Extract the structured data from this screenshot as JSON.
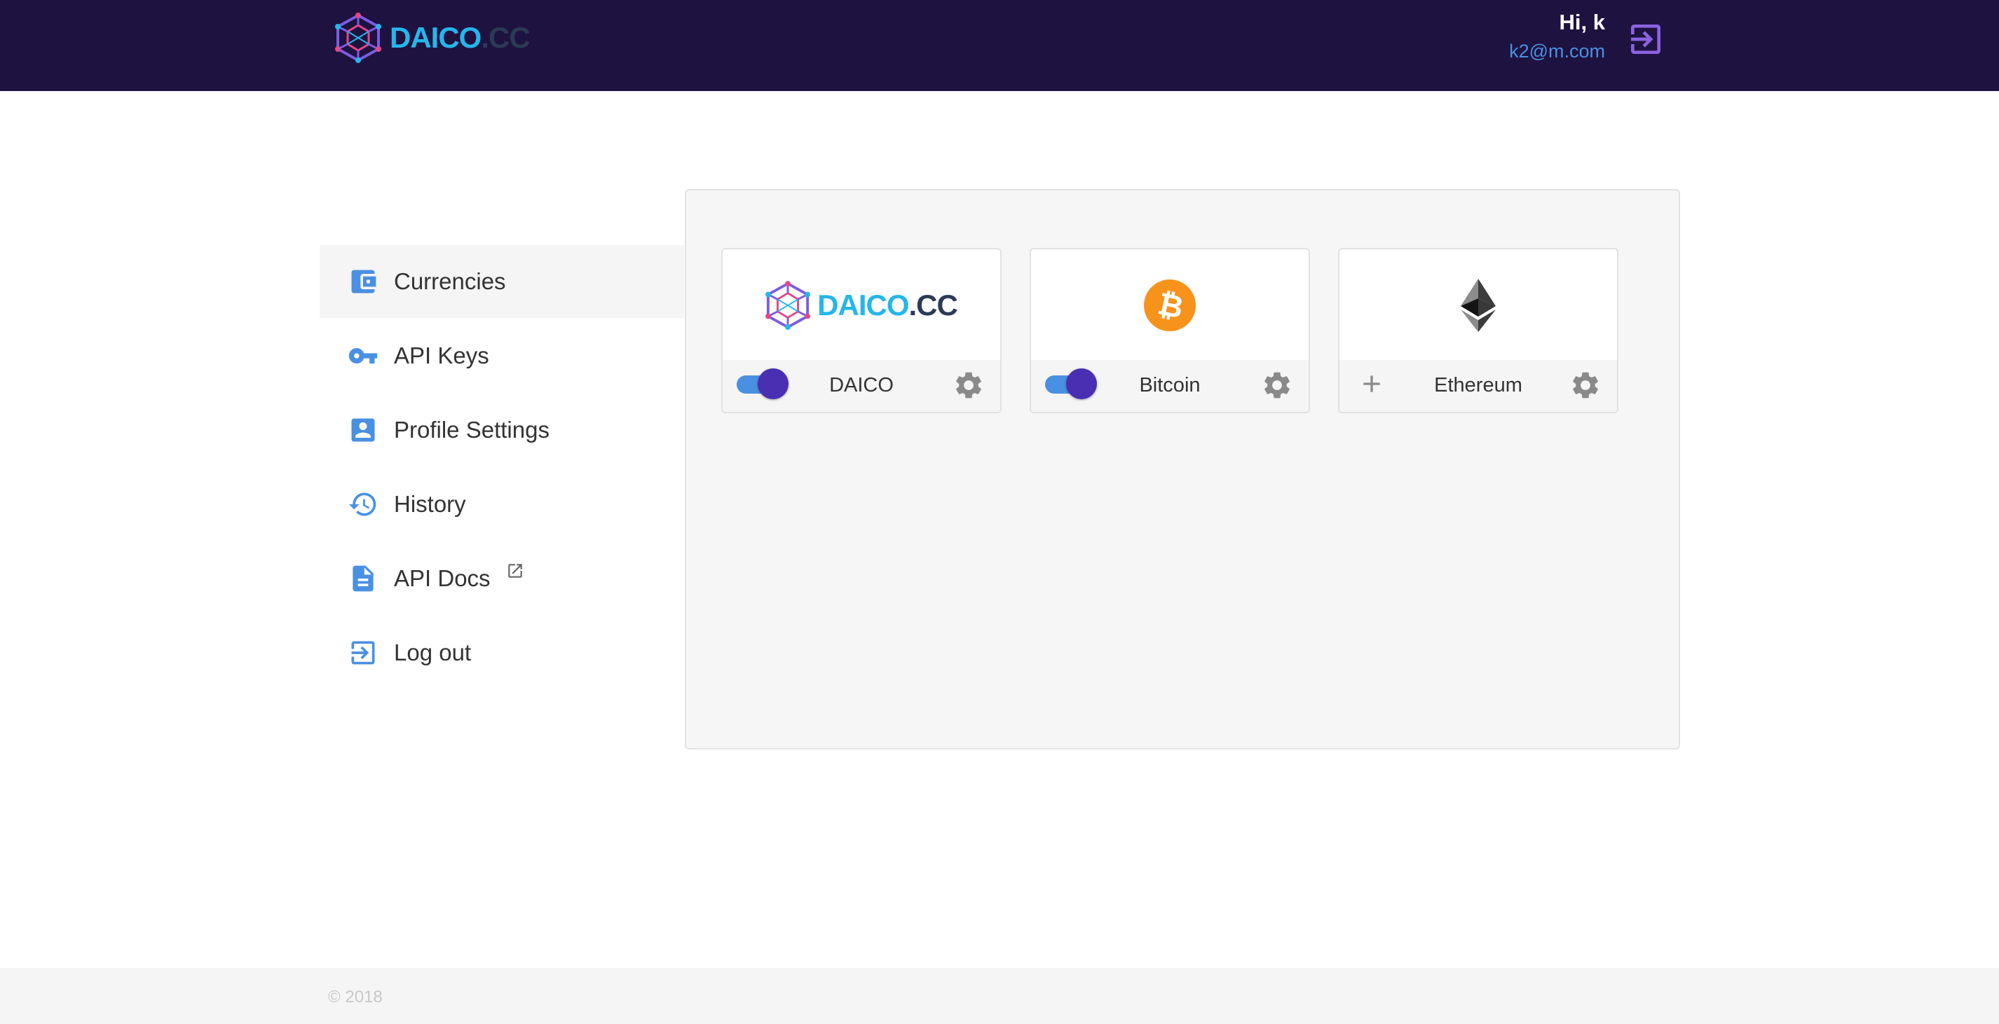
{
  "header": {
    "brand": {
      "part1": "DAICO",
      "part2": ".CC"
    },
    "greeting": "Hi, k",
    "email": "k2@m.com",
    "logout_icon": "logout-icon"
  },
  "sidebar": {
    "items": [
      {
        "label": "Currencies",
        "icon": "wallet-icon",
        "active": true
      },
      {
        "label": "API Keys",
        "icon": "key-icon",
        "active": false
      },
      {
        "label": "Profile Settings",
        "icon": "account-box-icon",
        "active": false
      },
      {
        "label": "History",
        "icon": "history-icon",
        "active": false
      },
      {
        "label": "API Docs",
        "icon": "document-icon",
        "external": true,
        "active": false
      },
      {
        "label": "Log out",
        "icon": "logout-icon",
        "active": false
      }
    ]
  },
  "currencies": [
    {
      "name": "DAICO",
      "logo": "daico-logo",
      "logo_text1": "DAICO",
      "logo_text2": ".CC",
      "enabled": true
    },
    {
      "name": "Bitcoin",
      "logo": "bitcoin-logo",
      "enabled": true
    },
    {
      "name": "Ethereum",
      "logo": "ethereum-logo",
      "enabled": false
    }
  ],
  "footer": {
    "copyright": "© 2018"
  },
  "colors": {
    "header_bg": "#1e1240",
    "accent_blue": "#4a90e2",
    "toggle_knob": "#4a2fb2",
    "logout_purple": "#8a63e0",
    "brand_cyan": "#25b6ea",
    "brand_dark": "#2b3a55",
    "bitcoin_orange": "#f7931a"
  }
}
